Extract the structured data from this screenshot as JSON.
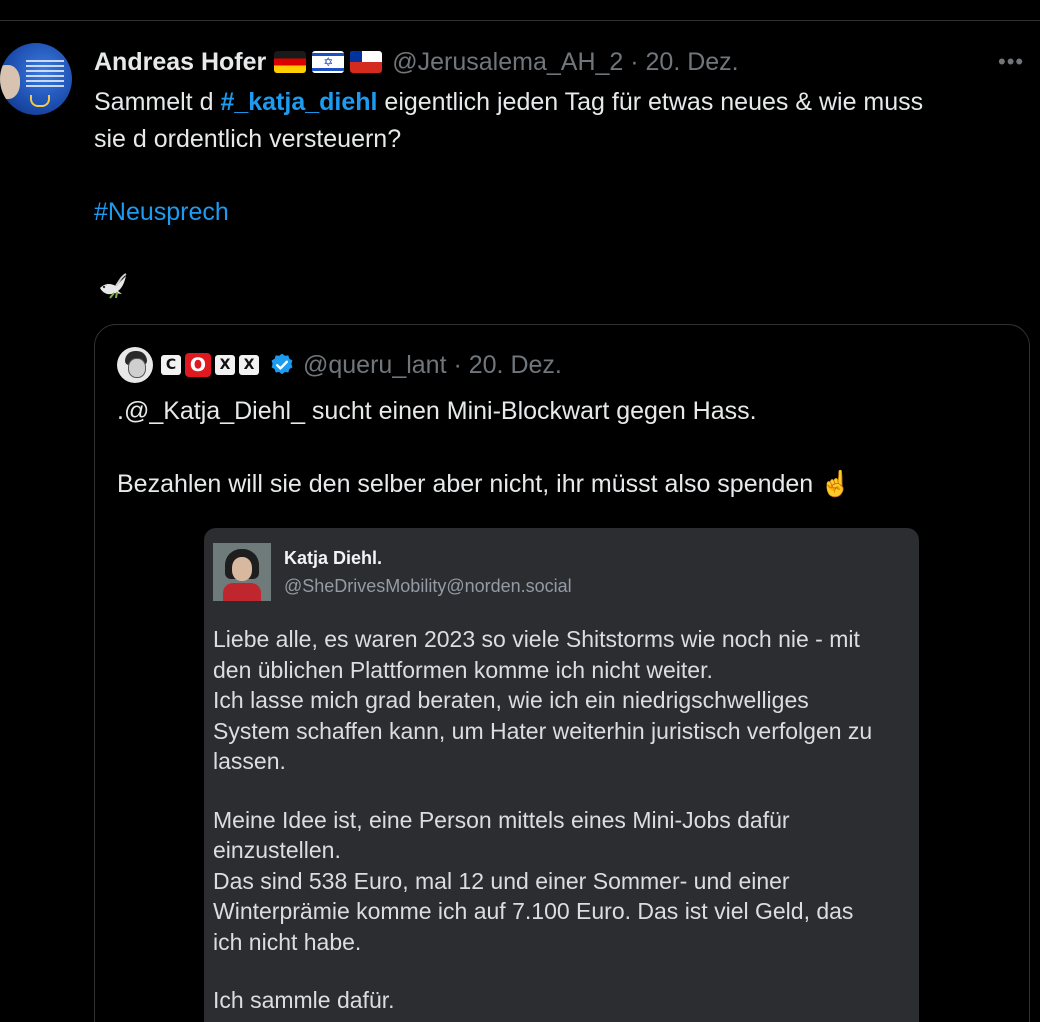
{
  "tweet": {
    "author_name": "Andreas Hofer",
    "flags": [
      "flag-germany-icon",
      "flag-israel-icon",
      "flag-chile-icon"
    ],
    "handle_date": "@Jerusalema_AH_2 · 20. Dez.",
    "more_icon": "more-options-icon",
    "text_line1_pre": "Sammelt d ",
    "text_line1_link": "#_katja_diehl",
    "text_line1_post": " eigentlich jeden Tag für etwas neues & wie muss",
    "text_line2": "sie d ordentlich versteuern?",
    "hashtag": "#Neusprech",
    "emoji_icon": "dove-icon"
  },
  "quote": {
    "badges": [
      "C",
      "O",
      "X",
      "X"
    ],
    "verified_icon": "verified-badge-icon",
    "handle_date": "@queru_lant · 20. Dez.",
    "line1": ".@_Katja_Diehl_ sucht einen Mini-Blockwart gegen Hass.",
    "line2": "Bezahlen will sie den selber aber nicht, ihr müsst also spenden",
    "line2_emoji": "☝️"
  },
  "embedded_post": {
    "name": "Katja Diehl.",
    "handle": "@SheDrivesMobility@norden.social",
    "p1_lines": [
      "Liebe alle, es waren 2023 so viele Shitstorms wie noch nie - mit",
      "den üblichen Plattformen komme ich nicht weiter.",
      "Ich lasse mich grad beraten, wie ich ein niedrigschwelliges",
      "System schaffen kann, um Hater weiterhin juristisch verfolgen zu",
      "lassen."
    ],
    "p2_lines": [
      "Meine Idee ist, eine Person mittels eines Mini-Jobs dafür",
      "einzustellen.",
      "Das sind 538 Euro, mal 12 und einer Sommer- und einer",
      "Winterprämie komme ich auf 7.100 Euro. Das ist viel Geld, das",
      "ich nicht habe."
    ],
    "p3_lines": [
      "Ich sammle dafür."
    ]
  },
  "colors": {
    "link": "#1d9bf0",
    "muted": "#71767b",
    "text": "#e7e9ea",
    "border": "#2f3336",
    "embedded_bg": "#2b2d31"
  }
}
